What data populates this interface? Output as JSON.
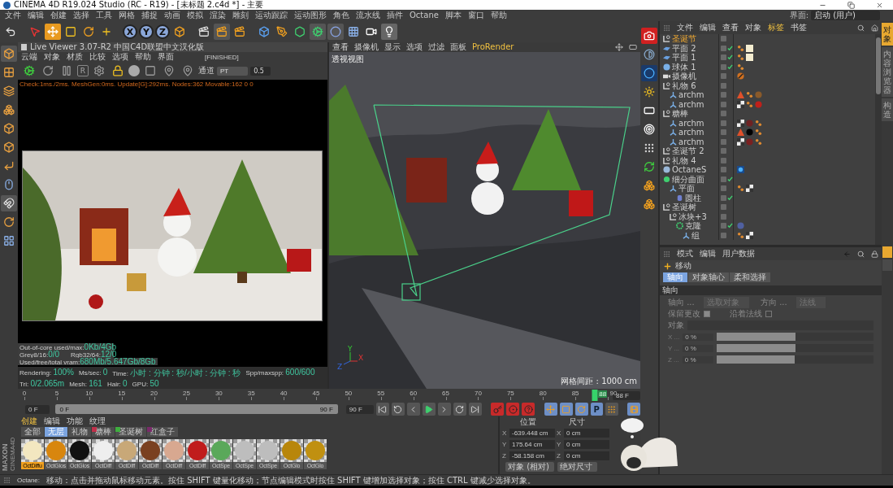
{
  "window": {
    "title": "CINEMA 4D R19.024 Studio (RC - R19) - [未标题 2.c4d *] - 主要"
  },
  "menu": [
    "文件",
    "编辑",
    "创建",
    "选择",
    "工具",
    "网格",
    "捕捉",
    "动画",
    "模拟",
    "渲染",
    "雕刻",
    "运动跟踪",
    "运动图形",
    "角色",
    "流水线",
    "插件",
    "Octane",
    "脚本",
    "窗口",
    "帮助"
  ],
  "layout_picker": {
    "label": "界面:",
    "value": "启动 (用户)"
  },
  "axis_buttons": [
    "X",
    "Y",
    "Z"
  ],
  "live_viewer": {
    "title": "Live Viewer 3.07-R2 中国C4D联盟中文汉化版",
    "menu": [
      "云端",
      "对象",
      "材质",
      "比较",
      "选项",
      "帮助",
      "界面"
    ],
    "status": "[FINISHED]",
    "toolbar_letter": "R",
    "channel_label": "通道",
    "channel": "PT",
    "value": "0.5",
    "log": "Check:1ms./2ms. MeshGen:0ms. Update[G]:292ms. Nodes:362 Movable:162  0 0",
    "stats": [
      [
        {
          "label": "Out-of-core used/max:",
          "value": "0Kb/4Gb"
        }
      ],
      [
        {
          "label": "Grey8/16:",
          "value": "0/0"
        },
        {
          "label": "Rgb32/64:",
          "value": "12/0"
        }
      ],
      [
        {
          "label": "Used/free/total vram:",
          "value": "680Mb/5.647Gb/8Gb"
        }
      ]
    ],
    "footer": [
      {
        "label": "Rendering:",
        "value": "100%"
      },
      {
        "label": "Ms/sec:",
        "value": "0"
      },
      {
        "label": "Time:",
        "value": "小时 : 分钟 : 秒/小时 : 分钟 : 秒"
      },
      {
        "label": "Spp/maxspp:",
        "value": "600/600"
      },
      {
        "label": "Tri:",
        "value": "0/2.065m"
      },
      {
        "label": "Mesh:",
        "value": "161"
      },
      {
        "label": "Hair:",
        "value": "0"
      },
      {
        "label": "GPU:",
        "value": "50"
      }
    ]
  },
  "viewport": {
    "menu": [
      "查看",
      "摄像机",
      "显示",
      "选项",
      "过滤",
      "面板",
      "ProRender"
    ],
    "label": "透视视图",
    "grid_info": "网格间距 : 1000 cm",
    "axis_labels": [
      "Y",
      "X",
      "Z"
    ]
  },
  "timeline": {
    "ticks": [
      "0",
      "5",
      "10",
      "15",
      "20",
      "25",
      "30",
      "35",
      "40",
      "45",
      "50",
      "55",
      "60",
      "65",
      "70",
      "75",
      "80",
      "85",
      "90"
    ],
    "current_frame": "88",
    "level": 0.978,
    "frame_field": "88 F",
    "start_field": "0 F",
    "range": {
      "start": "0 F",
      "end": "90 F",
      "level": 1
    },
    "end_field": "90 F",
    "param_key": "P"
  },
  "materials": {
    "menu": [
      "创建",
      "编辑",
      "功能",
      "纹理"
    ],
    "tabs": [
      {
        "label": "全部",
        "selected": false
      },
      {
        "label": "无层",
        "selected": true
      },
      {
        "label": "礼物",
        "selected": false
      },
      {
        "label": "糖棒",
        "selected": false,
        "color": "#c0304a"
      },
      {
        "label": "圣诞树",
        "selected": false,
        "color": "#3fae3f"
      },
      {
        "label": "红盒子",
        "selected": false,
        "color": "#7a2a6a"
      }
    ],
    "items": [
      {
        "name": "OctDiffu",
        "color": "#f3e7c0",
        "selected": true
      },
      {
        "name": "OctGlos",
        "color": "#d8860e",
        "selected": false
      },
      {
        "name": "OctGlos",
        "color": "#111111",
        "selected": false
      },
      {
        "name": "OctDiff",
        "color": "#eeeeee",
        "selected": false
      },
      {
        "name": "OctDiff",
        "color": "#c8a878",
        "selected": false
      },
      {
        "name": "OctDiff",
        "color": "#7a4020",
        "selected": false
      },
      {
        "name": "OctDiff",
        "color": "#d8a890",
        "selected": false
      },
      {
        "name": "OctDiff",
        "color": "#c01c1c",
        "selected": false
      },
      {
        "name": "OctSpe",
        "color": "#5aa85a",
        "selected": false
      },
      {
        "name": "OctSpe",
        "color": "#bdbdbd",
        "selected": false
      },
      {
        "name": "OctSpe",
        "color": "#bdbdbd",
        "selected": false
      },
      {
        "name": "OctGlo",
        "color": "#b8860b",
        "selected": false
      },
      {
        "name": "OctGlo",
        "color": "#c09010",
        "selected": false
      }
    ]
  },
  "coordinates": {
    "headers": [
      "位置",
      "尺寸"
    ],
    "rows": [
      {
        "axis": "X",
        "position": "-639.448 cm",
        "size_axis": "X",
        "size": "0 cm"
      },
      {
        "axis": "Y",
        "position": "175.64 cm",
        "size_axis": "Y",
        "size": "0 cm"
      },
      {
        "axis": "Z",
        "position": "-58.158 cm",
        "size_axis": "Z",
        "size": "0 cm"
      }
    ],
    "modes": [
      "对象 (相对)",
      "绝对尺寸"
    ]
  },
  "object_manager": {
    "menu": [
      {
        "label": "文件",
        "selected": false
      },
      {
        "label": "编辑",
        "selected": false
      },
      {
        "label": "查看",
        "selected": false
      },
      {
        "label": "对象",
        "selected": false
      },
      {
        "label": "标签",
        "selected": true
      },
      {
        "label": "书签",
        "selected": false
      }
    ],
    "objects": [
      {
        "name": "圣诞节",
        "kind": "null",
        "selected": true,
        "enabled": false
      },
      {
        "name": "平面 2",
        "kind": "plane",
        "selected": false,
        "enabled": true,
        "tags": [
          {
            "kind": "dots"
          },
          {
            "kind": "glow"
          }
        ]
      },
      {
        "name": "平面 1",
        "kind": "plane",
        "selected": false,
        "enabled": true,
        "tags": [
          {
            "kind": "dots"
          },
          {
            "kind": "glow"
          }
        ]
      },
      {
        "name": "球体 1",
        "kind": "sphere",
        "selected": false,
        "enabled": true,
        "tags": [
          {
            "kind": "dots"
          }
        ]
      },
      {
        "name": "摄像机",
        "kind": "camera",
        "selected": false,
        "enabled": false,
        "tags": [
          {
            "kind": "target"
          }
        ]
      },
      {
        "name": "礼物 6",
        "kind": "null",
        "selected": false,
        "enabled": false,
        "children": [
          {
            "name": "archm",
            "kind": "poly",
            "selected": false,
            "enabled": false,
            "tags": [
              {
                "kind": "cone"
              },
              {
                "kind": "dots"
              },
              {
                "kind": "ball",
                "color": "#8a5a2a"
              }
            ]
          },
          {
            "name": "archm",
            "kind": "poly",
            "selected": false,
            "enabled": false,
            "tags": [
              {
                "kind": "checker"
              },
              {
                "kind": "dots"
              },
              {
                "kind": "ball",
                "color": "#c0201a"
              }
            ]
          }
        ]
      },
      {
        "name": "糖棒",
        "kind": "null",
        "selected": false,
        "enabled": false,
        "children": [
          {
            "name": "archm",
            "kind": "poly",
            "selected": false,
            "enabled": false,
            "tags": [
              {
                "kind": "checker"
              },
              {
                "kind": "ball",
                "color": "#6e2222"
              },
              {
                "kind": "dots"
              }
            ]
          },
          {
            "name": "archm",
            "kind": "poly",
            "selected": false,
            "enabled": false,
            "tags": [
              {
                "kind": "cone"
              },
              {
                "kind": "ball",
                "color": "#000000"
              },
              {
                "kind": "dots"
              }
            ]
          },
          {
            "name": "archm",
            "kind": "poly",
            "selected": false,
            "enabled": false,
            "tags": [
              {
                "kind": "checker"
              },
              {
                "kind": "ball",
                "color": "#7a2020"
              },
              {
                "kind": "dots"
              }
            ]
          }
        ]
      },
      {
        "name": "圣诞节 2",
        "kind": "null",
        "selected": false,
        "enabled": false
      },
      {
        "name": "礼物 4",
        "kind": "null",
        "selected": false,
        "enabled": false
      },
      {
        "name": "OctaneS",
        "kind": "sky",
        "selected": false,
        "enabled": false,
        "tags": [
          {
            "kind": "octane"
          }
        ]
      },
      {
        "name": "细分曲面",
        "kind": "subdiv",
        "selected": false,
        "enabled": true,
        "children": [
          {
            "name": "平面",
            "kind": "poly",
            "selected": false,
            "enabled": false,
            "tags": [
              {
                "kind": "dots"
              },
              {
                "kind": "checker"
              }
            ],
            "children": [
              {
                "name": "圆柱",
                "kind": "cylinder",
                "selected": false,
                "enabled": true
              }
            ]
          }
        ]
      },
      {
        "name": "圣诞树",
        "kind": "null",
        "selected": false,
        "enabled": false,
        "children": [
          {
            "name": "冰块+3",
            "kind": "null",
            "selected": false,
            "enabled": false,
            "children": [
              {
                "name": "克隆",
                "kind": "cloner",
                "selected": false,
                "enabled": true,
                "tags": [
                  {
                    "kind": "ball",
                    "color": "#5060a0"
                  }
                ],
                "children": [
                  {
                    "name": "组",
                    "kind": "poly",
                    "selected": false,
                    "enabled": false,
                    "tags": [
                      {
                        "kind": "dots"
                      },
                      {
                        "kind": "checker"
                      }
                    ]
                  }
                ]
              }
            ]
          }
        ]
      }
    ]
  },
  "dock_tabs": [
    {
      "label": "对象",
      "selected": true
    },
    {
      "label": "内容浏览器",
      "selected": false
    },
    {
      "label": "构造",
      "selected": false
    }
  ],
  "attributes": {
    "menu": [
      "模式",
      "编辑",
      "用户数据"
    ],
    "tool": "移动",
    "tabs": [
      {
        "label": "轴向",
        "selected": true
      },
      {
        "label": "对象轴心",
        "selected": false
      },
      {
        "label": "柔和选择",
        "selected": false
      }
    ],
    "section": "轴向",
    "dropdowns": [
      {
        "label": "轴向 ...",
        "value": "选取对象"
      },
      {
        "label": "方向 ...",
        "value": "法线"
      }
    ],
    "checks": [
      {
        "label": "保留更改",
        "checked": true
      },
      {
        "label": "沿着法线",
        "checked": false
      }
    ],
    "object_label": "对象",
    "sliders": [
      {
        "label": "X ...",
        "value": "0 %",
        "level": 0.5
      },
      {
        "label": "Y ...",
        "value": "0 %",
        "level": 0.5
      },
      {
        "label": "Z ...",
        "value": "0 %",
        "level": 0.5
      }
    ]
  },
  "logo": [
    "MAXON",
    "CINEMA4D"
  ],
  "status": {
    "label": "Octane:",
    "message": "移动：点击并拖动鼠标移动元素。按住 SHIFT 键量化移动；节点编辑模式时按住 SHIFT 键增加选择对象；按住 CTRL 键减少选择对象。"
  }
}
